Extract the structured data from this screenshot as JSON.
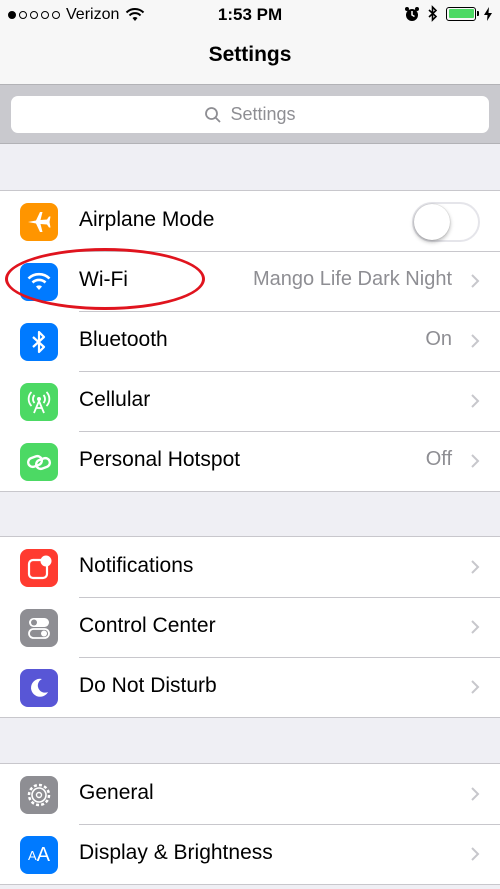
{
  "status_bar": {
    "carrier": "Verizon",
    "time": "1:53 PM",
    "signal_bars_filled": 1,
    "signal_bars_total": 5,
    "battery_level": 1.0,
    "battery_color": "#4cd964"
  },
  "nav": {
    "title": "Settings"
  },
  "search": {
    "placeholder": "Settings"
  },
  "groups": [
    {
      "items": [
        {
          "label": "Airplane Mode",
          "icon": "airplane-icon",
          "icon_color": "#ff9500",
          "toggle": false
        },
        {
          "label": "Wi-Fi",
          "icon": "wifi-icon",
          "icon_color": "#007aff",
          "value": "Mango Life Dark Night",
          "annotated": true
        },
        {
          "label": "Bluetooth",
          "icon": "bluetooth-icon",
          "icon_color": "#007aff",
          "value": "On"
        },
        {
          "label": "Cellular",
          "icon": "cellular-icon",
          "icon_color": "#4cd964",
          "value": ""
        },
        {
          "label": "Personal Hotspot",
          "icon": "hotspot-icon",
          "icon_color": "#4cd964",
          "value": "Off"
        }
      ]
    },
    {
      "items": [
        {
          "label": "Notifications",
          "icon": "notifications-icon",
          "icon_color": "#ff3b30"
        },
        {
          "label": "Control Center",
          "icon": "control-center-icon",
          "icon_color": "#8e8e93"
        },
        {
          "label": "Do Not Disturb",
          "icon": "moon-icon",
          "icon_color": "#5856d6"
        }
      ]
    },
    {
      "items": [
        {
          "label": "General",
          "icon": "gear-icon",
          "icon_color": "#8e8e93"
        },
        {
          "label": "Display & Brightness",
          "icon": "display-icon",
          "icon_color": "#007aff"
        }
      ]
    }
  ],
  "annotation_color": "#e0141e"
}
